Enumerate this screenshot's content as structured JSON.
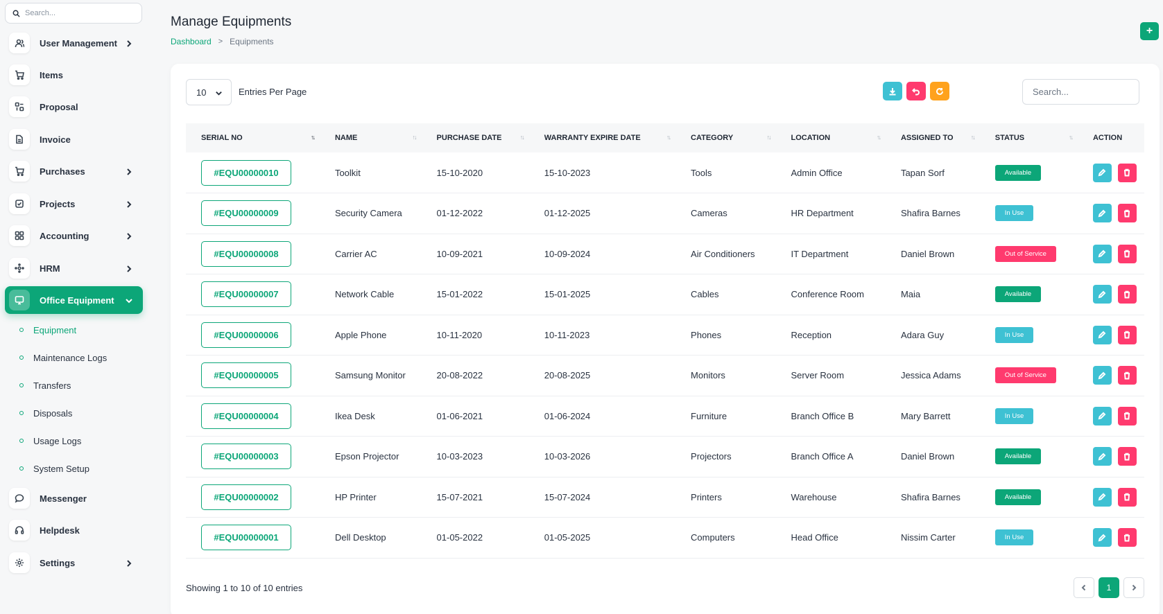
{
  "sidebar": {
    "search_placeholder": "Search...",
    "items": [
      {
        "label": "User Management",
        "icon": "users-icon",
        "chevron": "right"
      },
      {
        "label": "Items",
        "icon": "cart-icon",
        "chevron": ""
      },
      {
        "label": "Proposal",
        "icon": "proposal-icon",
        "chevron": ""
      },
      {
        "label": "Invoice",
        "icon": "file-icon",
        "chevron": ""
      },
      {
        "label": "Purchases",
        "icon": "cart-icon",
        "chevron": "right"
      },
      {
        "label": "Projects",
        "icon": "check-square-icon",
        "chevron": "right"
      },
      {
        "label": "Accounting",
        "icon": "grid-icon",
        "chevron": "right"
      },
      {
        "label": "HRM",
        "icon": "hrm-icon",
        "chevron": "right"
      },
      {
        "label": "Office Equipment",
        "icon": "monitor-icon",
        "chevron": "down"
      }
    ],
    "sub_items": [
      {
        "label": "Equipment"
      },
      {
        "label": "Maintenance Logs"
      },
      {
        "label": "Transfers"
      },
      {
        "label": "Disposals"
      },
      {
        "label": "Usage Logs"
      },
      {
        "label": "System Setup"
      }
    ],
    "bottom_items": [
      {
        "label": "Messenger",
        "icon": "chat-icon",
        "chevron": ""
      },
      {
        "label": "Helpdesk",
        "icon": "headset-icon",
        "chevron": ""
      },
      {
        "label": "Settings",
        "icon": "gear-icon",
        "chevron": "right"
      }
    ],
    "accent_color": "#0ca678"
  },
  "header": {
    "title": "Manage Equipments",
    "breadcrumb": {
      "home": "Dashboard",
      "separator": ">",
      "current": "Equipments"
    },
    "add_button_label": "+"
  },
  "toolbar": {
    "entries_value": "10",
    "entries_label": "Entries Per Page",
    "search_placeholder": "Search...",
    "buttons": [
      {
        "name": "download",
        "icon": "download-icon",
        "color": "#3ec1d3"
      },
      {
        "name": "undo",
        "icon": "undo-icon",
        "color": "#ff3a6e"
      },
      {
        "name": "refresh",
        "icon": "refresh-icon",
        "color": "#ffa21d"
      }
    ]
  },
  "table": {
    "columns": [
      "SERIAL NO",
      "NAME",
      "PURCHASE DATE",
      "WARRANTY EXPIRE DATE",
      "CATEGORY",
      "LOCATION",
      "ASSIGNED TO",
      "STATUS",
      "ACTION"
    ],
    "rows": [
      {
        "serial": "#EQU00000010",
        "name": "Toolkit",
        "purchase": "15-10-2020",
        "warranty": "15-10-2023",
        "category": "Tools",
        "location": "Admin Office",
        "assigned": "Tapan Sorf",
        "status": "Available"
      },
      {
        "serial": "#EQU00000009",
        "name": "Security Camera",
        "purchase": "01-12-2022",
        "warranty": "01-12-2025",
        "category": "Cameras",
        "location": "HR Department",
        "assigned": "Shafira Barnes",
        "status": "In Use"
      },
      {
        "serial": "#EQU00000008",
        "name": "Carrier AC",
        "purchase": "10-09-2021",
        "warranty": "10-09-2024",
        "category": "Air Conditioners",
        "location": "IT Department",
        "assigned": "Daniel Brown",
        "status": "Out of Service"
      },
      {
        "serial": "#EQU00000007",
        "name": "Network Cable",
        "purchase": "15-01-2022",
        "warranty": "15-01-2025",
        "category": "Cables",
        "location": "Conference Room",
        "assigned": "Maia",
        "status": "Available"
      },
      {
        "serial": "#EQU00000006",
        "name": "Apple Phone",
        "purchase": "10-11-2020",
        "warranty": "10-11-2023",
        "category": "Phones",
        "location": "Reception",
        "assigned": "Adara Guy",
        "status": "In Use"
      },
      {
        "serial": "#EQU00000005",
        "name": "Samsung Monitor",
        "purchase": "20-08-2022",
        "warranty": "20-08-2025",
        "category": "Monitors",
        "location": "Server Room",
        "assigned": "Jessica Adams",
        "status": "Out of Service"
      },
      {
        "serial": "#EQU00000004",
        "name": "Ikea Desk",
        "purchase": "01-06-2021",
        "warranty": "01-06-2024",
        "category": "Furniture",
        "location": "Branch Office B",
        "assigned": "Mary Barrett",
        "status": "In Use"
      },
      {
        "serial": "#EQU00000003",
        "name": "Epson Projector",
        "purchase": "10-03-2023",
        "warranty": "10-03-2026",
        "category": "Projectors",
        "location": "Branch Office A",
        "assigned": "Daniel Brown",
        "status": "Available"
      },
      {
        "serial": "#EQU00000002",
        "name": "HP Printer",
        "purchase": "15-07-2021",
        "warranty": "15-07-2024",
        "category": "Printers",
        "location": "Warehouse",
        "assigned": "Shafira Barnes",
        "status": "Available"
      },
      {
        "serial": "#EQU00000001",
        "name": "Dell Desktop",
        "purchase": "01-05-2022",
        "warranty": "01-05-2025",
        "category": "Computers",
        "location": "Head Office",
        "assigned": "Nissim Carter",
        "status": "In Use"
      }
    ],
    "status_colors": {
      "Available": "#0ca678",
      "In Use": "#3ec1d3",
      "Out of Service": "#ff3a6e"
    },
    "action_colors": {
      "edit": "#3ec1d3",
      "delete": "#ff3a6e"
    }
  },
  "footer": {
    "showing_text": "Showing 1 to 10 of 10 entries",
    "current_page": "1"
  }
}
